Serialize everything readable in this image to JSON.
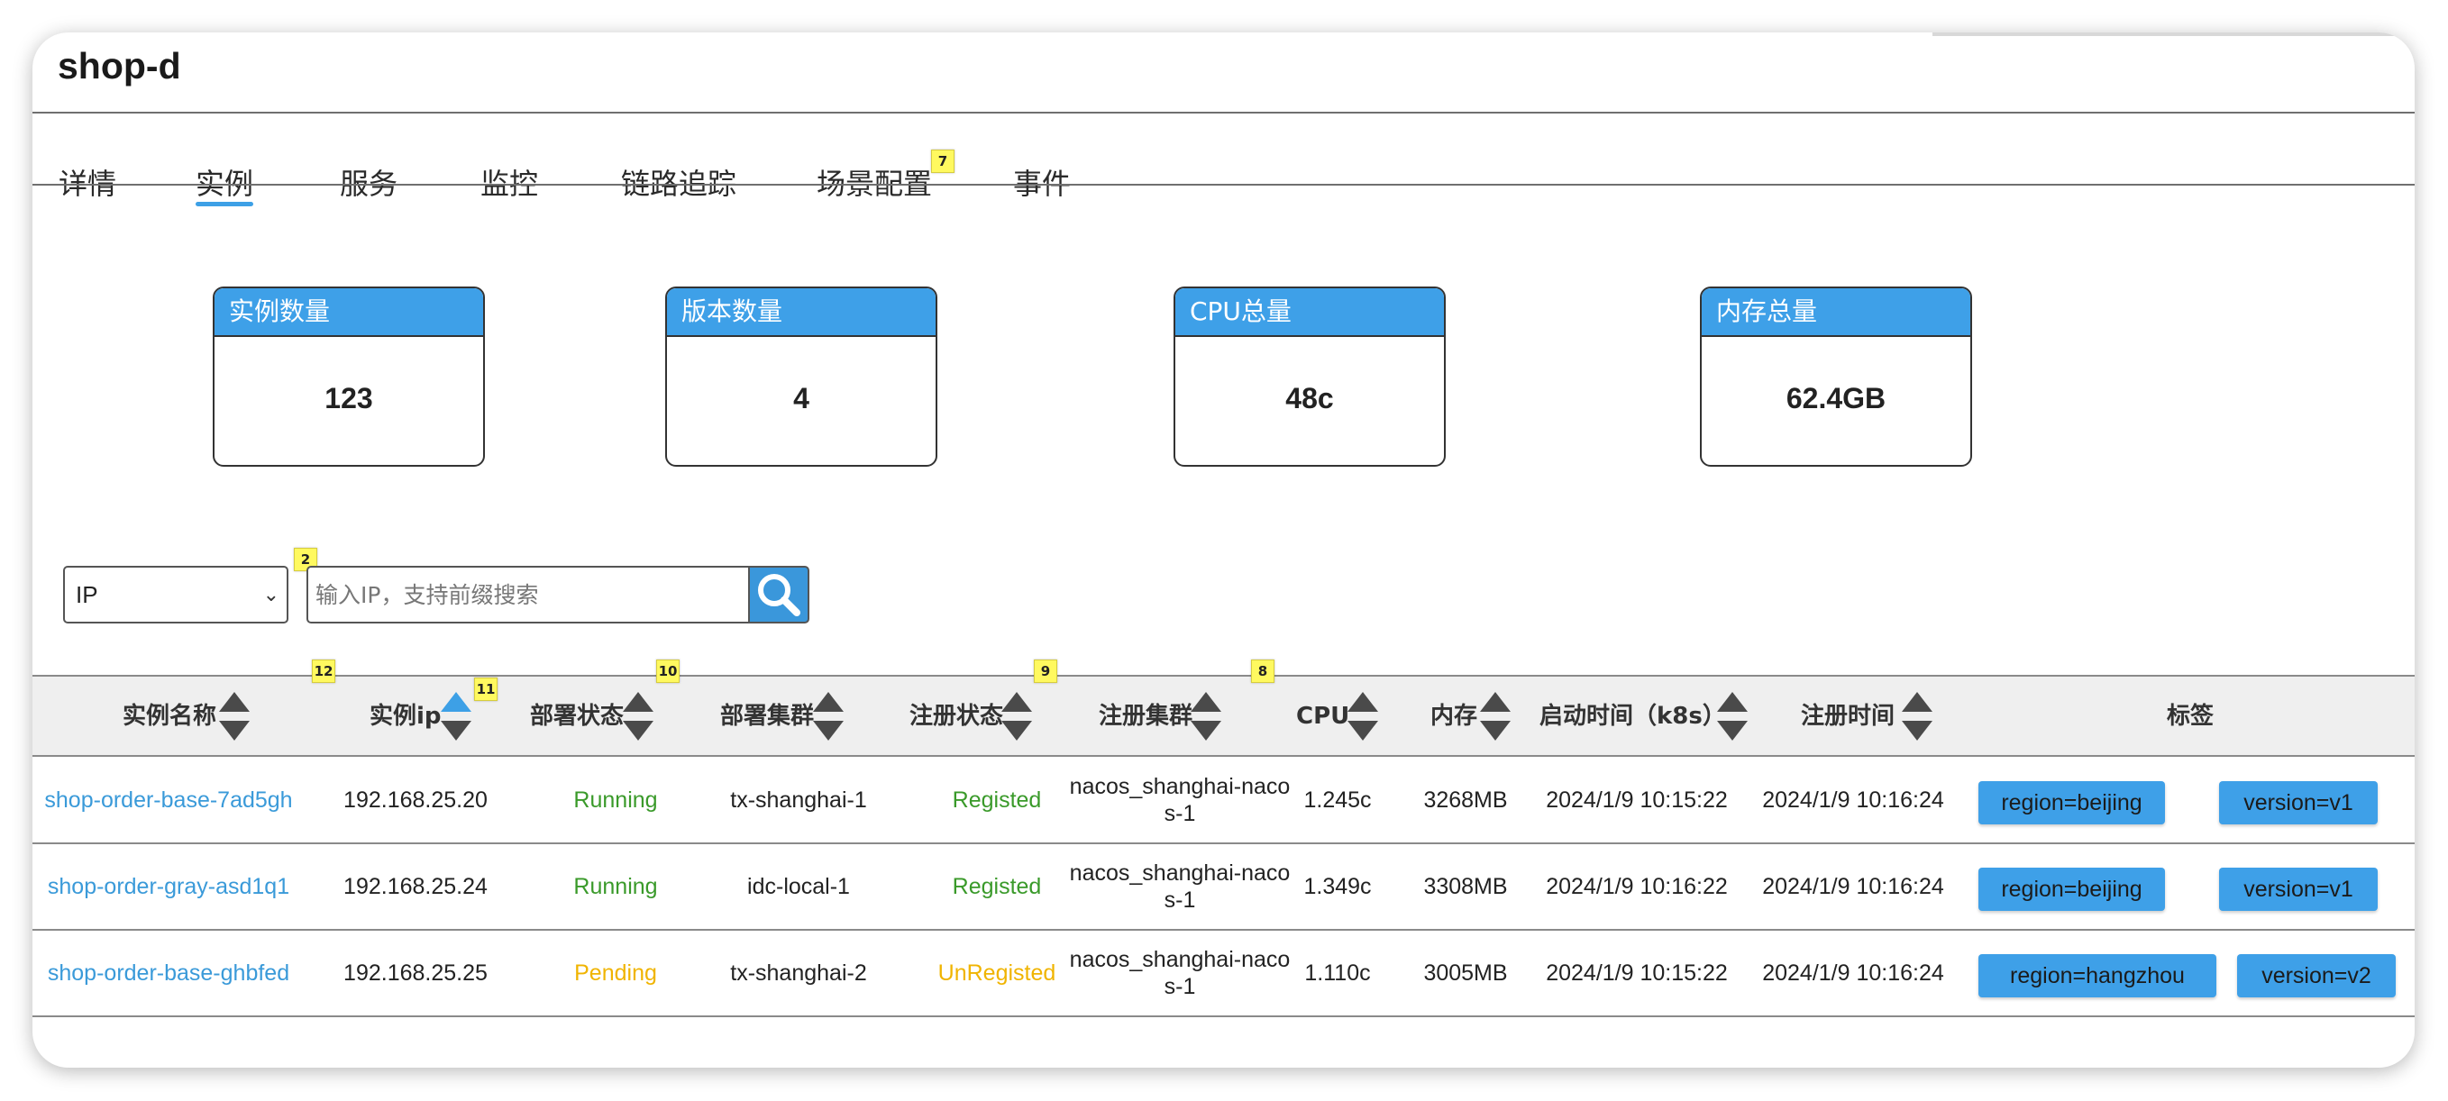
{
  "app": {
    "title": "shop-d"
  },
  "tabs": [
    {
      "label": "详情"
    },
    {
      "label": "实例"
    },
    {
      "label": "服务"
    },
    {
      "label": "监控"
    },
    {
      "label": "链路追踪"
    },
    {
      "label": "场景配置"
    },
    {
      "label": "事件"
    }
  ],
  "active_tab": "实例",
  "badges": {
    "scene": "7",
    "search": "2",
    "col_name": "12",
    "col_ip": "11",
    "col_deploy_status": "10",
    "col_reg_status": "9",
    "col_reg_cluster": "8"
  },
  "stats": [
    {
      "label": "实例数量",
      "value": "123"
    },
    {
      "label": "版本数量",
      "value": "4"
    },
    {
      "label": "CPU总量",
      "value": "48c"
    },
    {
      "label": "内存总量",
      "value": "62.4GB"
    }
  ],
  "filter": {
    "selected": "IP",
    "placeholder": "输入IP，支持前缀搜索",
    "value": ""
  },
  "table": {
    "columns": [
      "实例名称",
      "实例ip",
      "部署状态",
      "部署集群",
      "注册状态",
      "注册集群",
      "CPU",
      "内存",
      "启动时间（k8s）",
      "注册时间",
      "标签"
    ],
    "sorted_column": "实例ip",
    "sort_direction": "asc",
    "rows": [
      {
        "name": "shop-order-base-7ad5gh",
        "ip": "192.168.25.20",
        "deploy_status": "Running",
        "deploy_cluster": "tx-shanghai-1",
        "reg_status": "Registed",
        "reg_cluster": "nacos_shanghai-nacos-1",
        "cpu": "1.245c",
        "mem": "3268MB",
        "start_time": "2024/1/9 10:15:22",
        "reg_time": "2024/1/9 10:16:24",
        "tags": [
          "region=beijing",
          "version=v1"
        ]
      },
      {
        "name": "shop-order-gray-asd1q1",
        "ip": "192.168.25.24",
        "deploy_status": "Running",
        "deploy_cluster": "idc-local-1",
        "reg_status": "Registed",
        "reg_cluster": "nacos_shanghai-nacos-1",
        "cpu": "1.349c",
        "mem": "3308MB",
        "start_time": "2024/1/9 10:16:22",
        "reg_time": "2024/1/9 10:16:24",
        "tags": [
          "region=beijing",
          "version=v1"
        ]
      },
      {
        "name": "shop-order-base-ghbfed",
        "ip": "192.168.25.25",
        "deploy_status": "Pending",
        "deploy_cluster": "tx-shanghai-2",
        "reg_status": "UnRegisted",
        "reg_cluster": "nacos_shanghai-nacos-1",
        "cpu": "1.110c",
        "mem": "3005MB",
        "start_time": "2024/1/9 10:15:22",
        "reg_time": "2024/1/9 10:16:24",
        "tags": [
          "region=hangzhou",
          "version=v2"
        ]
      }
    ]
  },
  "colors": {
    "accent": "#3da0e6",
    "running": "#3a9a2a",
    "pending": "#f0b400",
    "link": "#3a9ad9",
    "badge": "#fff95f"
  },
  "icons": {
    "search": "search-icon",
    "select": "chevron-down-icon",
    "sort": "sort-icon"
  }
}
